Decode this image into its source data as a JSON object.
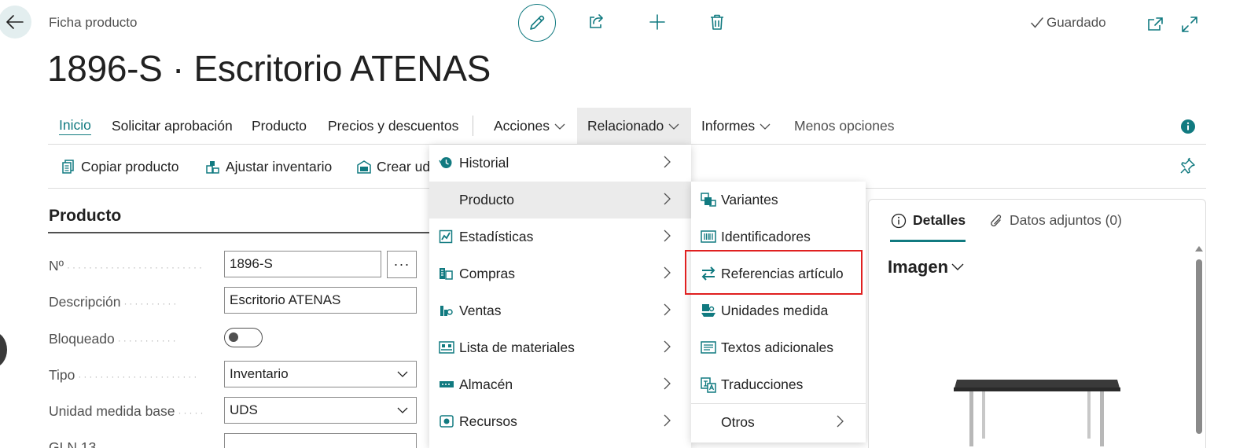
{
  "header": {
    "caption": "Ficha producto",
    "title": "1896-S · Escritorio ATENAS",
    "saved_status": "Guardado"
  },
  "action_bar": {
    "items": [
      {
        "label": "Inicio"
      },
      {
        "label": "Solicitar aprobación"
      },
      {
        "label": "Producto"
      },
      {
        "label": "Precios y descuentos"
      },
      {
        "label": "Acciones"
      },
      {
        "label": "Relacionado"
      },
      {
        "label": "Informes"
      },
      {
        "label": "Menos opciones"
      }
    ]
  },
  "sub_bar": {
    "items": [
      {
        "label": "Copiar producto"
      },
      {
        "label": "Ajustar inventario"
      },
      {
        "label": "Crear ud"
      }
    ]
  },
  "section": {
    "title": "Producto"
  },
  "fields": {
    "no": {
      "label": "Nº",
      "value": "1896-S",
      "assist": "···"
    },
    "description": {
      "label": "Descripción",
      "value": "Escritorio ATENAS"
    },
    "blocked": {
      "label": "Bloqueado",
      "checked": false
    },
    "type": {
      "label": "Tipo",
      "value": "Inventario"
    },
    "base_unit": {
      "label": "Unidad medida base",
      "value": "UDS"
    },
    "gtin": {
      "label": "GLN 13"
    }
  },
  "menu_related": {
    "items": [
      {
        "label": "Historial",
        "icon": "history-icon"
      },
      {
        "label": "Producto",
        "icon": "none"
      },
      {
        "label": "Estadísticas",
        "icon": "statistics-icon"
      },
      {
        "label": "Compras",
        "icon": "purchases-icon"
      },
      {
        "label": "Ventas",
        "icon": "sales-icon"
      },
      {
        "label": "Lista de materiales",
        "icon": "bom-icon"
      },
      {
        "label": "Almacén",
        "icon": "warehouse-icon"
      },
      {
        "label": "Recursos",
        "icon": "resources-icon"
      }
    ]
  },
  "menu_product": {
    "items": [
      {
        "label": "Variantes",
        "icon": "variants-icon"
      },
      {
        "label": "Identificadores",
        "icon": "barcode-icon"
      },
      {
        "label": "Referencias artículo",
        "icon": "swap-arrows-icon"
      },
      {
        "label": "Unidades medida",
        "icon": "units-icon"
      },
      {
        "label": "Textos adicionales",
        "icon": "text-icon"
      },
      {
        "label": "Traducciones",
        "icon": "translate-icon"
      },
      {
        "label": "Otros",
        "icon": "none"
      }
    ]
  },
  "right_panel": {
    "tab_details": "Detalles",
    "tab_attachments": "Datos adjuntos (0)",
    "image_heading": "Imagen"
  },
  "colors": {
    "accent": "#117a80",
    "highlight": "#e02020"
  }
}
